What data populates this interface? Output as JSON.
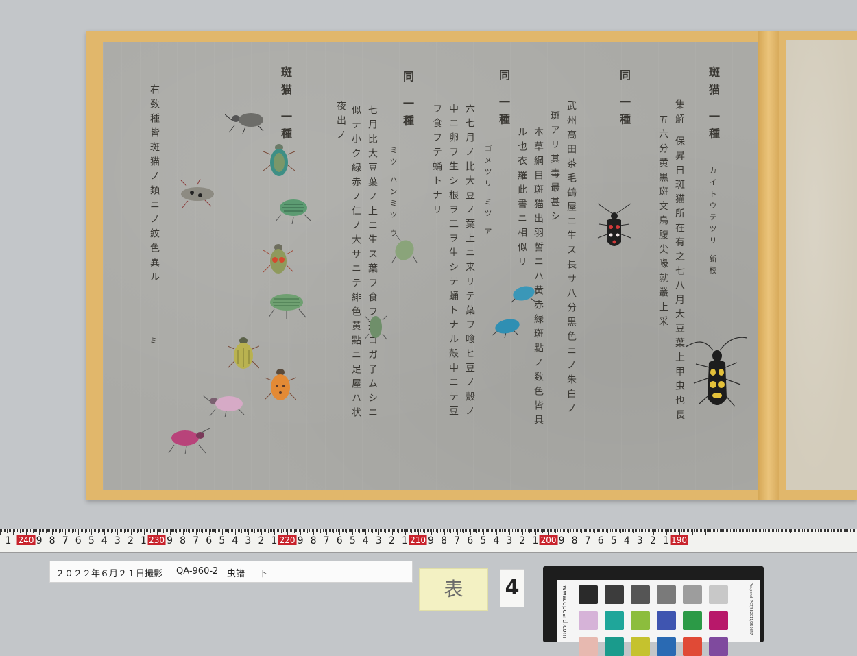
{
  "sheet": {
    "columns": [
      {
        "id": "c1a",
        "text": "斑猫 一種",
        "style": "title"
      },
      {
        "id": "c1b",
        "text": "集解 保昇日斑猫所在有之七八月大豆葉上甲虫也長",
        "style": "normal"
      },
      {
        "id": "c1c",
        "text": "五六分黄黒斑文鳥腹尖喙就叢上采",
        "style": "normal"
      },
      {
        "id": "c1d",
        "text": "カイトウテツリ 新校",
        "style": "small"
      },
      {
        "id": "c2a",
        "text": "同 一種",
        "style": "title"
      },
      {
        "id": "c2b",
        "text": "武州高田茶毛鶴屋ニ生ス長サ八分黒色ニノ朱白ノ",
        "style": "normal"
      },
      {
        "id": "c2c",
        "text": "斑アリ其毒最甚シ",
        "style": "normal"
      },
      {
        "id": "c2d",
        "text": "本草綱目斑猫出羽誓ニハ黄赤緑斑點ノ数色皆具",
        "style": "normal"
      },
      {
        "id": "c2e",
        "text": "ル也衣羅此書ニ相似リ",
        "style": "normal"
      },
      {
        "id": "c3a",
        "text": "同 一種",
        "style": "title"
      },
      {
        "id": "c3b",
        "text": "六七月ノ比大豆ノ葉上ニ来リテ葉ヲ喰ヒ豆ノ殻ノ",
        "style": "normal"
      },
      {
        "id": "c3c",
        "text": "中ニ卵ヲ生シ根ヲ二ヲ生シテ蛹トナル殻中ニテ豆",
        "style": "normal"
      },
      {
        "id": "c3d",
        "text": "ヲ食フテ蛹トナリ",
        "style": "normal"
      },
      {
        "id": "c3e",
        "text": "ゴメツリ ミツ ア",
        "style": "small"
      },
      {
        "id": "c4a",
        "text": "同 一種",
        "style": "title"
      },
      {
        "id": "c4b",
        "text": "七月比大豆葉ノ上ニ生ス葉ヲ食フ形コガ子ムシニ",
        "style": "normal"
      },
      {
        "id": "c4c",
        "text": "似テ小ク緑赤ノ仁ノ大サニテ緋色黄點ニ足屋ハ状",
        "style": "normal"
      },
      {
        "id": "c4d",
        "text": "夜出ノ",
        "style": "normal"
      },
      {
        "id": "c4e",
        "text": "ミツ ハンミツ ウ",
        "style": "small"
      },
      {
        "id": "c5a",
        "text": "斑猫 一種",
        "style": "title"
      },
      {
        "id": "c6a",
        "text": "右数種皆斑猫ノ類ニノ紋色異ル",
        "style": "normal"
      },
      {
        "id": "c6b",
        "text": "ミ",
        "style": "small"
      }
    ]
  },
  "ruler": {
    "major_labels": [
      "240",
      "230",
      "220",
      "210",
      "200",
      "190"
    ],
    "minor_labels": [
      "9",
      "8",
      "7",
      "6",
      "5",
      "4",
      "3",
      "2",
      "1"
    ]
  },
  "label_strip": {
    "date": "２０２２年６月２１日撮影",
    "catalog": "QA-960-2",
    "title": "虫譜",
    "volume": "下"
  },
  "note": "表",
  "card_number": "4",
  "color_card": {
    "vertical_text": "www.qpcard.com",
    "vertical_text_right": "Pat.pend. PCT/SE2011/050847",
    "swatches_row1": [
      "#2a2a2a",
      "#3c3c3c",
      "#555555",
      "#7a7a7a",
      "#9d9d9d",
      "#c8c8c8"
    ],
    "swatches_row2": [
      "#d6b3d8",
      "#1fa69a",
      "#8cbd3d",
      "#3f55b0",
      "#2c9a47",
      "#b8186a"
    ],
    "swatches_row3": [
      "#e7b9b0",
      "#1a9b8c",
      "#c5c22e",
      "#2a6ab3",
      "#e04a36",
      "#7f4a9e"
    ]
  },
  "colors": {
    "board": "#e1b76b",
    "paper": "#aaaaa6",
    "ruler_red": "#c8232c"
  }
}
